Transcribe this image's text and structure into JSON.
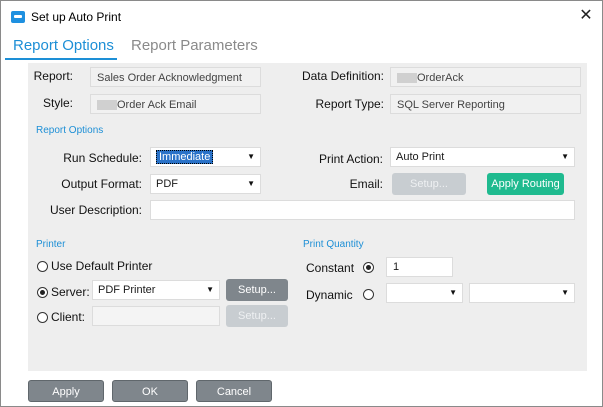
{
  "window": {
    "title": "Set up Auto Print",
    "close_icon": "close-icon"
  },
  "tabs": [
    {
      "label": "Report Options",
      "active": true
    },
    {
      "label": "Report Parameters",
      "active": false
    }
  ],
  "report": {
    "report_label": "Report:",
    "report_value": "Sales Order Acknowledgment",
    "style_label": "Style:",
    "style_value": "Order Ack Email",
    "data_definition_label": "Data Definition:",
    "data_definition_value": "OrderAck",
    "report_type_label": "Report Type:",
    "report_type_value": "SQL Server Reporting"
  },
  "report_options": {
    "section_title": "Report Options",
    "run_schedule_label": "Run Schedule:",
    "run_schedule_value": "Immediate",
    "output_format_label": "Output Format:",
    "output_format_value": "PDF",
    "user_description_label": "User Description:",
    "user_description_value": "",
    "print_action_label": "Print Action:",
    "print_action_value": "Auto Print",
    "email_label": "Email:",
    "email_setup_label": "Setup...",
    "apply_routing_label": "Apply Routing"
  },
  "printer": {
    "section_title": "Printer",
    "use_default_label": "Use Default Printer",
    "server_label": "Server:",
    "server_value": "PDF Printer",
    "server_setup_label": "Setup...",
    "client_label": "Client:",
    "client_value": "",
    "client_setup_label": "Setup...",
    "selected": "server"
  },
  "print_quantity": {
    "section_title": "Print Quantity",
    "constant_label": "Constant",
    "constant_value": "1",
    "dynamic_label": "Dynamic",
    "dynamic_value_1": "",
    "dynamic_value_2": "",
    "selected": "constant"
  },
  "footer": {
    "apply_label": "Apply",
    "ok_label": "OK",
    "cancel_label": "Cancel"
  },
  "colors": {
    "accent": "#1d8fd6",
    "button_grey": "#7f868c",
    "apply_routing_green": "#1fba8f",
    "panel_bg": "#eeeeee"
  }
}
